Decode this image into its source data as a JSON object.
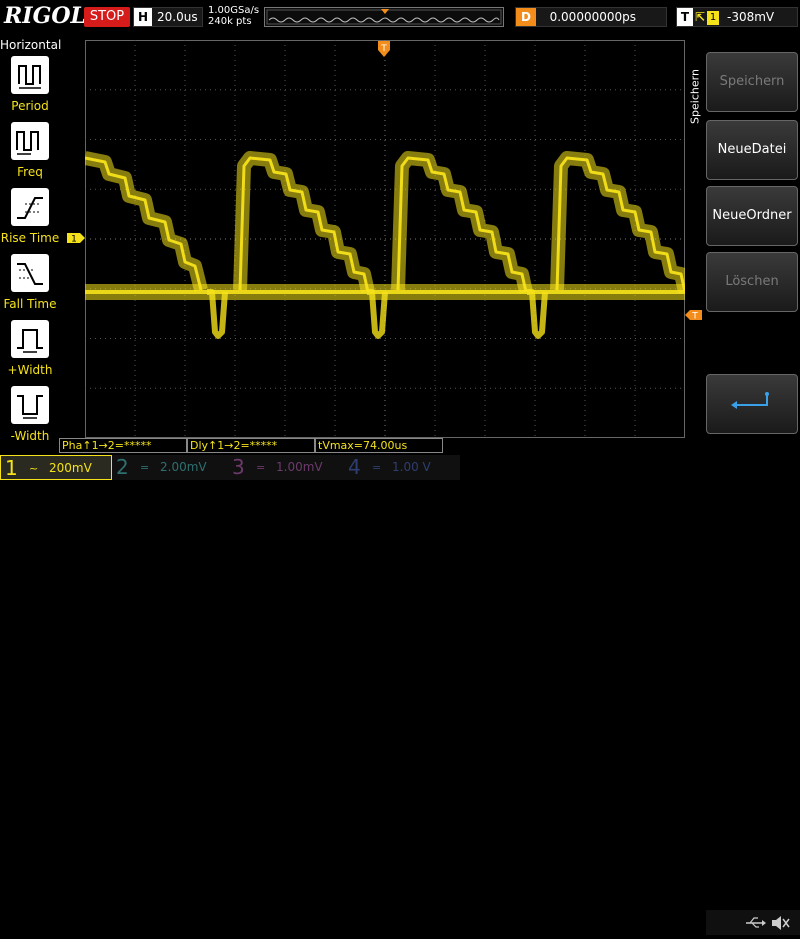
{
  "topbar": {
    "logo": "RIGOL",
    "run_state": "STOP",
    "timebase_key": "H",
    "timebase_value": "20.0us",
    "sample_rate": "1.00GSa/s",
    "memory_depth": "240k pts",
    "delay_key": "D",
    "delay_value": "0.00000000ps",
    "trigger_key": "T",
    "trigger_source": "1",
    "trigger_level": "-308mV"
  },
  "horizontal_menu": {
    "title": "Horizontal",
    "items": [
      {
        "label": "Period",
        "icon": "period-icon"
      },
      {
        "label": "Freq",
        "icon": "freq-icon"
      },
      {
        "label": "Rise Time",
        "icon": "rise-time-icon"
      },
      {
        "label": "Fall Time",
        "icon": "fall-time-icon"
      },
      {
        "label": "+Width",
        "icon": "positive-width-icon"
      },
      {
        "label": "-Width",
        "icon": "negative-width-icon"
      }
    ]
  },
  "right_menu": {
    "tab_label": "Speichern",
    "buttons": [
      {
        "label": "Speichern",
        "enabled": false
      },
      {
        "label": "NeueDatei",
        "enabled": true
      },
      {
        "label": "NeueOrdner",
        "enabled": true
      },
      {
        "label": "Löschen",
        "enabled": false
      },
      {
        "label": "",
        "icon": "return-arrow-icon",
        "enabled": true
      }
    ]
  },
  "markers": {
    "trigger_position": "T",
    "ch1_ground": "1",
    "trigger_level": "T"
  },
  "measurements": [
    {
      "text": "Pha↑1→2=*****"
    },
    {
      "text": "Dly↑1→2=*****"
    },
    {
      "text": "tVmax=74.00us"
    }
  ],
  "channels": [
    {
      "num": "1",
      "coupling": "~",
      "scale": "200mV",
      "active": true,
      "color": "#f5e21a"
    },
    {
      "num": "2",
      "coupling": "=",
      "scale": "2.00mV",
      "active": false,
      "color": "#2f6f6f"
    },
    {
      "num": "3",
      "coupling": "=",
      "scale": "1.00mV",
      "active": false,
      "color": "#6b3a6b"
    },
    {
      "num": "4",
      "coupling": "=",
      "scale": "1.00 V",
      "active": false,
      "color": "#2f3e70"
    }
  ],
  "colors": {
    "ch1": "#f5e21a",
    "stop": "#d61b1b",
    "delay": "#f28c1a",
    "marker": "#f28c1a"
  },
  "status_icons": [
    "usb-icon",
    "speaker-muted-icon"
  ]
}
